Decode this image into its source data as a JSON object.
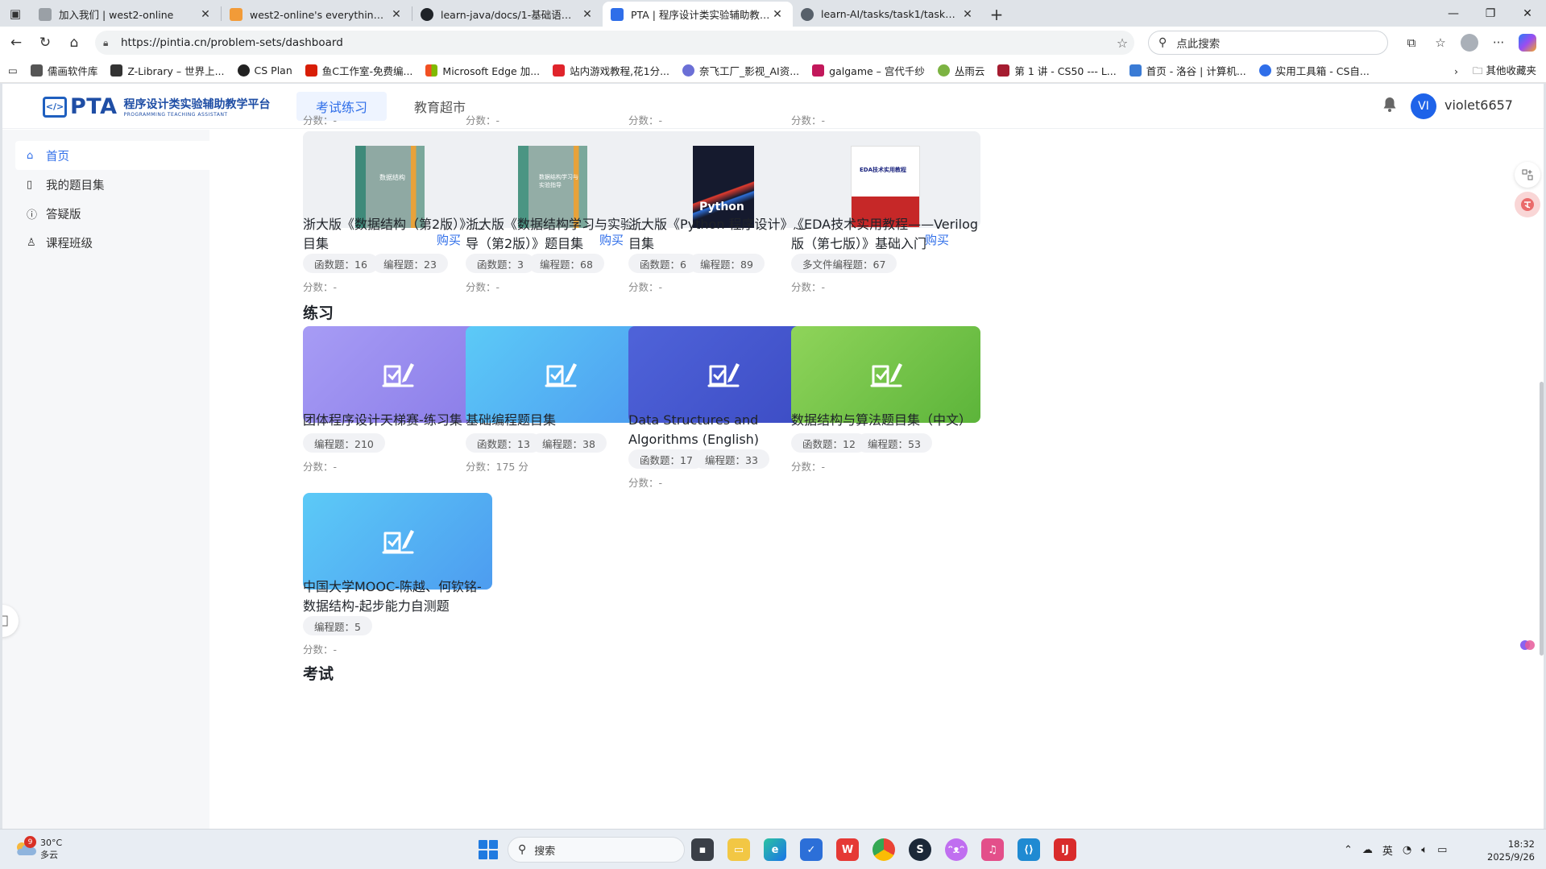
{
  "browser": {
    "tabs": [
      {
        "label": "加入我们 | west2-online",
        "active": false,
        "favicon_color": "#9aa0a6"
      },
      {
        "label": "west2-online's everything! - 飞书",
        "active": false,
        "favicon_color": "#f29b38"
      },
      {
        "label": "learn-java/docs/1-基础语法.md at",
        "active": false,
        "favicon_color": "#1f2328"
      },
      {
        "label": "PTA | 程序设计类实验辅助教学平",
        "active": true,
        "favicon_color": "#2f6ee9"
      },
      {
        "label": "learn-AI/tasks/task1/task1.md at",
        "active": false,
        "favicon_color": "#57606a"
      }
    ],
    "address_url": "https://pintia.cn/problem-sets/dashboard",
    "search_placeholder": "点此搜索",
    "bookmarks": [
      {
        "label": "儒画软件库",
        "color": "#555"
      },
      {
        "label": "Z-Library – 世界上...",
        "color": "#333"
      },
      {
        "label": "CS Plan",
        "color": "#222"
      },
      {
        "label": "鱼C工作室-免费编...",
        "color": "#d81e06"
      },
      {
        "label": "Microsoft Edge 加...",
        "color": "#f25022"
      },
      {
        "label": "站内游戏教程,花1分...",
        "color": "#e0242b"
      },
      {
        "label": "奈飞工厂_影视_AI资...",
        "color": "#6b6fd6"
      },
      {
        "label": "galgame – 宫代千纱",
        "color": "#c2185b"
      },
      {
        "label": "丛雨云",
        "color": "#7cb342"
      },
      {
        "label": "第 1 讲 - CS50 --- L...",
        "color": "#a51c30"
      },
      {
        "label": "首页 - 洛谷 | 计算机...",
        "color": "#3a7bd5"
      },
      {
        "label": "实用工具箱 - CS自...",
        "color": "#2f6ee9"
      }
    ],
    "bookmarks_other": "其他收藏夹"
  },
  "header": {
    "logo_text": "PTA",
    "logo_cn": "程序设计类实验辅助教学平台",
    "logo_en": "PROGRAMMING TEACHING ASSISTANT",
    "nav_tabs": [
      {
        "label": "考试练习",
        "active": true
      },
      {
        "label": "教育超市",
        "active": false
      }
    ],
    "avatar_initials": "VI",
    "username": "violet6657"
  },
  "sidebar": {
    "items": [
      {
        "label": "首页",
        "icon": "home-icon",
        "active": true
      },
      {
        "label": "我的题目集",
        "icon": "book-icon",
        "active": false
      },
      {
        "label": "答疑版",
        "icon": "question-icon",
        "active": false
      },
      {
        "label": "课程班级",
        "icon": "users-icon",
        "active": false
      }
    ]
  },
  "top_scores": [
    "分数：-",
    "分数：-",
    "分数：-",
    "分数：-"
  ],
  "books": [
    {
      "title": "浙大版《数据结构（第2版）》题目集",
      "buy": "购买",
      "chips": [
        "函数题：16",
        "编程题：23"
      ],
      "score": "分数：-",
      "cover_color": "#3f8a7a",
      "cover_title": "数据结构"
    },
    {
      "title": "浙大版《数据结构学习与实验指导（第2版）》题目集",
      "buy": "购买",
      "chips": [
        "函数题：3",
        "编程题：68"
      ],
      "score": "分数：-",
      "cover_color": "#4b9583",
      "cover_title": "数据结构学习与实验指导"
    },
    {
      "title": "浙大版《Python 程序设计》题目集",
      "buy": "",
      "chips": [
        "函数题：6",
        "编程题：89"
      ],
      "score": "分数：-",
      "cover_color": "#151a2e",
      "cover_title": "Python"
    },
    {
      "title": "《EDA技术实用教程——Verilog版（第七版）》基础入门",
      "buy": "购买",
      "chips": [
        "多文件编程题：67"
      ],
      "score": "分数：-",
      "cover_color": "#ffffff",
      "cover_title": "EDA技术实用教程"
    }
  ],
  "practice": {
    "section_title": "练习",
    "items": [
      {
        "title": "团体程序设计天梯赛-练习集",
        "chips": [
          "编程题：210"
        ],
        "score": "分数：-",
        "gradient": [
          "#a79cf5",
          "#8a7ce8"
        ]
      },
      {
        "title": "基础编程题目集",
        "chips": [
          "函数题：13",
          "编程题：38"
        ],
        "score": "分数：175 分",
        "gradient": [
          "#5ccaf7",
          "#4d9cf0"
        ]
      },
      {
        "title": "Data Structures and Algorithms (English)",
        "chips": [
          "函数题：17",
          "编程题：33"
        ],
        "score": "分数：-",
        "gradient": [
          "#4f63d9",
          "#3c4cc4"
        ]
      },
      {
        "title": "数据结构与算法题目集（中文）",
        "chips": [
          "函数题：12",
          "编程题：53"
        ],
        "score": "分数：-",
        "gradient": [
          "#8fd45a",
          "#5cb43a"
        ]
      },
      {
        "title": "中国大学MOOC-陈越、何钦铭-数据结构-起步能力自测题",
        "chips": [
          "编程题：5"
        ],
        "score": "分数：-",
        "gradient": [
          "#5ccaf7",
          "#4d9cf0"
        ]
      }
    ]
  },
  "exam": {
    "section_title": "考试"
  },
  "taskbar": {
    "weather_temp": "30°C",
    "weather_desc": "多云",
    "weather_badge": "9",
    "search_label": "搜索",
    "ime": "英",
    "time": "18:32",
    "date": "2025/9/26"
  }
}
